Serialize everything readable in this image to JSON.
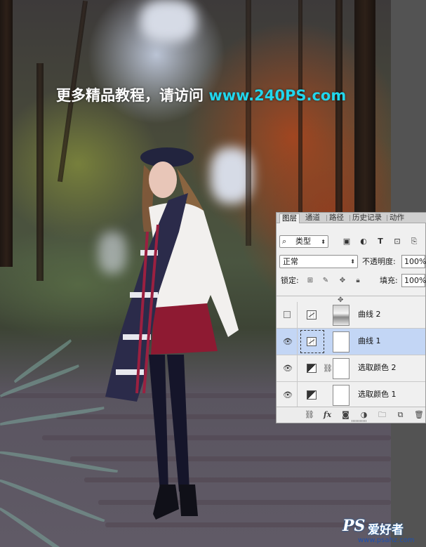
{
  "headline": {
    "text": "更多精品教程，请访问 ",
    "url": "www.240PS.com"
  },
  "layers_panel": {
    "tabs": [
      {
        "label": "图层",
        "active": true
      },
      {
        "label": "通道",
        "active": false
      },
      {
        "label": "路径",
        "active": false
      },
      {
        "label": "历史记录",
        "active": false
      },
      {
        "label": "动作",
        "active": false
      }
    ],
    "filter": {
      "label": "类型",
      "icons": [
        "image-filter-icon",
        "adjustment-filter-icon",
        "type-filter-icon",
        "shape-filter-icon",
        "smart-object-filter-icon"
      ]
    },
    "blend_mode": "正常",
    "opacity_label": "不透明度:",
    "opacity_value": "100%",
    "lock_label": "锁定:",
    "fill_label": "填充:",
    "fill_value": "100%",
    "layers": [
      {
        "name": "曲线 2",
        "visible": false,
        "selected": false,
        "type": "curves",
        "mask": "photo"
      },
      {
        "name": "曲线 1",
        "visible": true,
        "selected": true,
        "type": "curves",
        "mask": "white"
      },
      {
        "name": "选取颜色 2",
        "visible": true,
        "selected": false,
        "type": "selective-color",
        "mask": "white",
        "linked": true
      },
      {
        "name": "选取颜色 1",
        "visible": true,
        "selected": false,
        "type": "selective-color",
        "mask": "white"
      }
    ],
    "bottom_icons": [
      "link-layers-icon",
      "fx-icon",
      "add-mask-icon",
      "new-adjustment-icon",
      "new-group-icon",
      "new-layer-icon",
      "delete-layer-icon"
    ]
  },
  "watermark": {
    "logo": "PS",
    "text": "爱好者",
    "url": "www.psahz.com"
  }
}
